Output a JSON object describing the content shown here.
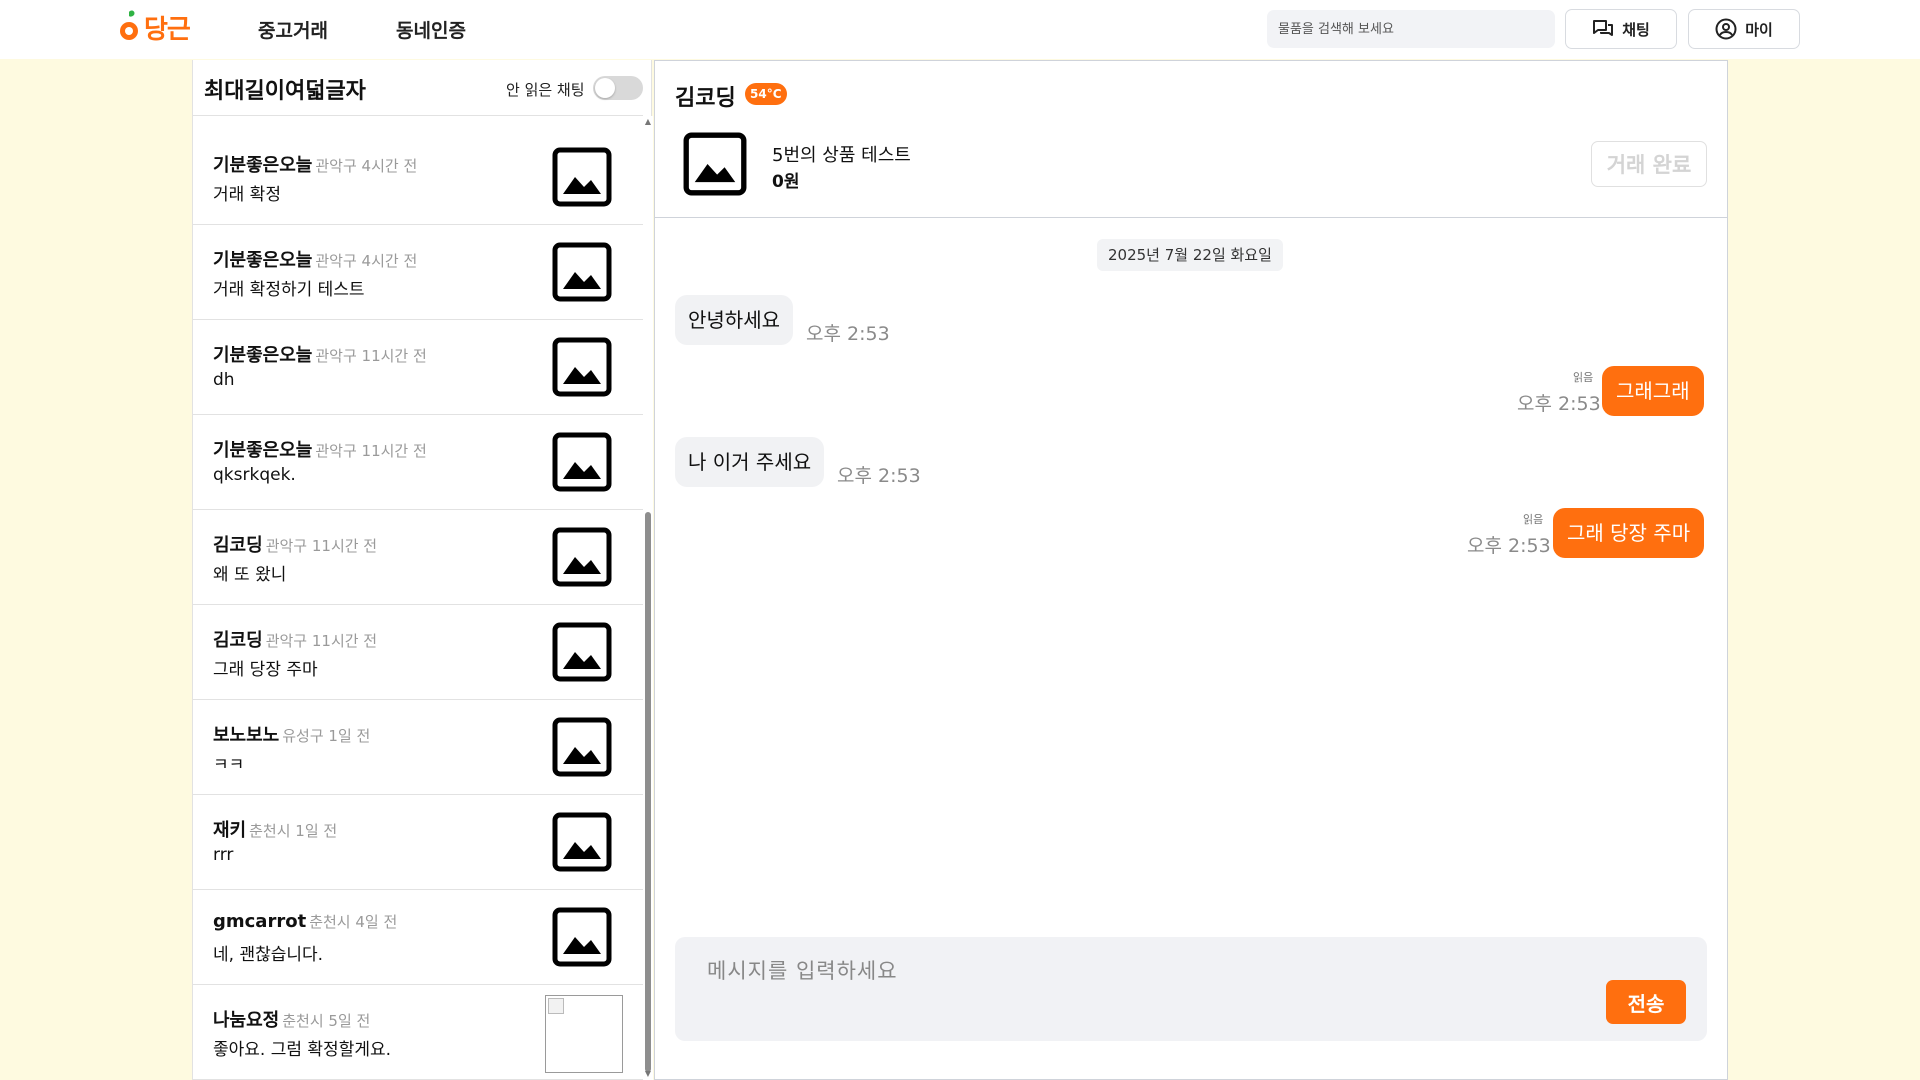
{
  "brand": {
    "name": "당근",
    "accent": "#ff6f0f"
  },
  "nav": {
    "used_trade": "중고거래",
    "neighborhood": "동네인증"
  },
  "search": {
    "placeholder": "물품을 검색해 보세요"
  },
  "header_buttons": {
    "chat": "채팅",
    "my": "마이"
  },
  "chat_list": {
    "title": "최대길이여덟글자",
    "unread_toggle_label": "안 읽은 채팅",
    "unread_toggle_on": false,
    "rooms": [
      {
        "name": "기분좋은오늘",
        "meta": "관악구 4시간 전",
        "message": "거래 확정"
      },
      {
        "name": "기분좋은오늘",
        "meta": "관악구 4시간 전",
        "message": "거래 확정하기 테스트"
      },
      {
        "name": "기분좋은오늘",
        "meta": "관악구 11시간 전",
        "message": "dh"
      },
      {
        "name": "기분좋은오늘",
        "meta": "관악구 11시간 전",
        "message": "qksrkqek."
      },
      {
        "name": "김코딩",
        "meta": "관악구 11시간 전",
        "message": "왜 또 왔니"
      },
      {
        "name": "김코딩",
        "meta": "관악구 11시간 전",
        "message": "그래 당장 주마"
      },
      {
        "name": "보노보노",
        "meta": "유성구 1일 전",
        "message": "ㅋㅋ"
      },
      {
        "name": "재키",
        "meta": "춘천시 1일 전",
        "message": "rrr"
      },
      {
        "name": "gmcarrot",
        "meta": "춘천시 4일 전",
        "message": "네, 괜찮습니다."
      },
      {
        "name": "나눔요정",
        "meta": "춘천시 5일 전",
        "message": "좋아요. 그럼 확정할게요."
      }
    ]
  },
  "conversation": {
    "partner_name": "김코딩",
    "temperature": "54°C",
    "product": {
      "title": "5번의 상품 테스트",
      "price": "0원"
    },
    "complete_button": "거래 완료",
    "date_divider": "2025년 7월 22일 화요일",
    "messages": [
      {
        "direction": "in",
        "text": "안녕하세요",
        "time": "오후 2:53"
      },
      {
        "direction": "out",
        "text": "그래그래",
        "time": "오후 2:53",
        "read": "읽음"
      },
      {
        "direction": "in",
        "text": "나 이거 주세요",
        "time": "오후 2:53"
      },
      {
        "direction": "out",
        "text": "그래 당장 주마",
        "time": "오후 2:53",
        "read": "읽음"
      }
    ],
    "composer_placeholder": "메시지를 입력하세요",
    "send_button": "전송"
  }
}
